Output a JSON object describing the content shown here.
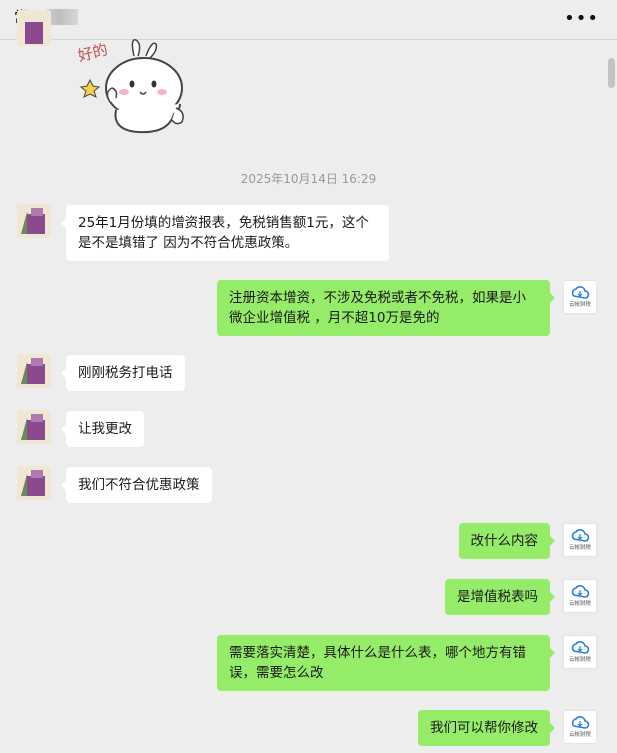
{
  "header": {
    "title": "常州",
    "more_icon": "more-dots-icon"
  },
  "timestamp": "2025年10月14日 16:29",
  "messages": [
    {
      "side": "left",
      "text": "25年1月份填的增资报表，免税销售额1元，这个是不是填错了 因为不符合优惠政策。"
    },
    {
      "side": "right",
      "text": "注册资本增资，不涉及免税或者不免税，如果是小微企业增值税 ，月不超10万是免的"
    },
    {
      "side": "left",
      "text": "刚刚税务打电话"
    },
    {
      "side": "left",
      "text": "让我更改"
    },
    {
      "side": "left",
      "text": "我们不符合优惠政策"
    },
    {
      "side": "right",
      "text": "改什么内容"
    },
    {
      "side": "right",
      "text": "是增值税表吗"
    },
    {
      "side": "right",
      "text": "需要落实清楚，具体什么是什么表，哪个地方有错误，需要怎么改"
    },
    {
      "side": "right",
      "text": "我们可以帮你修改"
    }
  ],
  "sticker": {
    "text": "好的",
    "icon": "bunny-ok-sticker"
  },
  "right_avatar": {
    "brand": "云帐财税",
    "icon": "cloud-logo-icon"
  },
  "left_avatar": {
    "icon": "user-avatar-icon"
  }
}
